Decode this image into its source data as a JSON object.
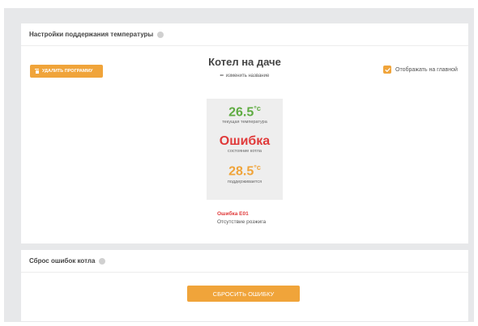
{
  "colors": {
    "accent": "#f0a43a",
    "ok": "#5fac42",
    "error": "#e03a3a",
    "panel_bg": "#ffffff",
    "page_bg": "#e7e8ea"
  },
  "settings": {
    "header": "Настройки поддержания температуры",
    "delete_label": "УДАЛИТЬ ПРОГРАММУ",
    "device_name": "Котел на даче",
    "rename_label": "изменить название",
    "show_main_label": "Отображать на главной",
    "show_main_checked": true,
    "status": {
      "current_temp": "26.5",
      "current_temp_unit": "°c",
      "current_temp_label": "текущая температура",
      "boiler_state": "Ошибка",
      "boiler_state_label": "состояние котла",
      "target_temp": "28.5",
      "target_temp_unit": "°c",
      "target_temp_label": "поддерживается"
    },
    "error_code": "Ошибка E01",
    "error_desc": "Отсутствие розжига"
  },
  "reset": {
    "header": "Сброс ошибок котла",
    "button_label": "СБРОСИТЬ ОШИБКУ"
  }
}
